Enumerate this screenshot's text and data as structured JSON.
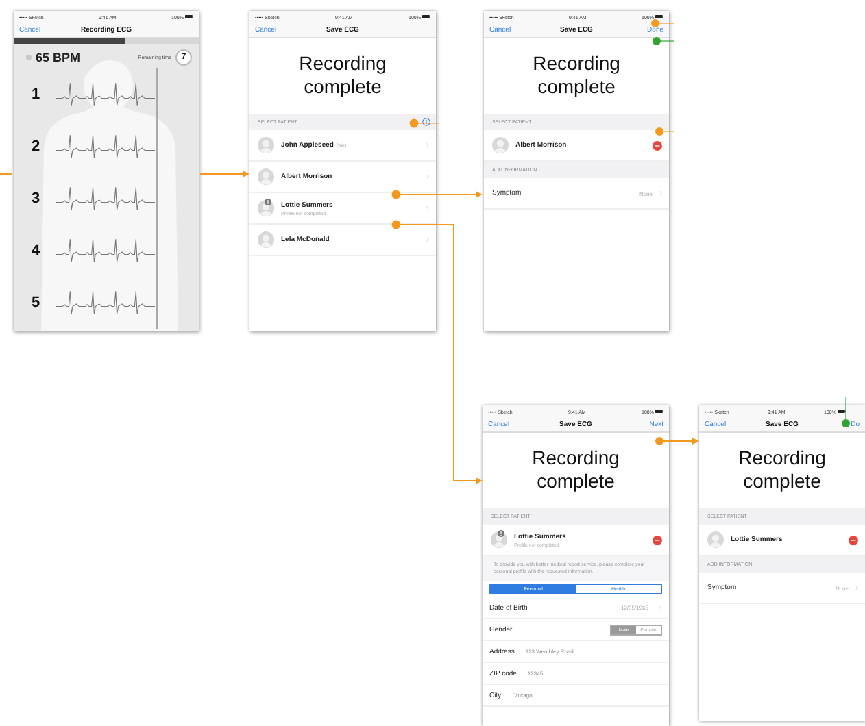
{
  "screens": [
    {
      "kind": "recording",
      "status": {
        "carrier": "••••• Sketch",
        "time": "9:41 AM",
        "battery": "100%"
      },
      "nav": {
        "left": "Cancel",
        "title": "Recording ECG"
      },
      "progress": {
        "level": 0.6
      },
      "bpm": "65 BPM",
      "remaining_label": "Remaining time",
      "remaining": "7",
      "leads": [
        "1",
        "2",
        "3",
        "4",
        "5"
      ]
    },
    {
      "kind": "save",
      "status": {
        "carrier": "••••• Sketch",
        "time": "9:41 AM",
        "battery": "100%"
      },
      "nav": {
        "left": "Cancel",
        "title": "Save ECG"
      },
      "heading": "Recording complete",
      "sections": [
        {
          "header": "SELECT PATIENT",
          "info": true,
          "rows": [
            {
              "kind": "patient",
              "name": "John Appleseed",
              "tag": "(me)",
              "deletable": false
            },
            {
              "kind": "patient",
              "name": "Albert Morrison",
              "deletable": false
            },
            {
              "kind": "patient",
              "name": "Lottie Summers",
              "subtitle": "Profile not completed",
              "badge": true,
              "deletable": false
            },
            {
              "kind": "patient",
              "name": "Lela McDonald",
              "deletable": false
            }
          ]
        }
      ]
    },
    {
      "kind": "save",
      "status": {
        "carrier": "••••• Sketch",
        "time": "9:41 AM",
        "battery": "100%"
      },
      "nav": {
        "left": "Cancel",
        "title": "Save ECG",
        "right": "Done"
      },
      "heading": "Recording complete",
      "sections": [
        {
          "header": "SELECT PATIENT",
          "rows": [
            {
              "kind": "patient",
              "name": "Albert Morrison",
              "deletable": true
            }
          ]
        },
        {
          "header": "ADD INFORMATION",
          "rows": [
            {
              "kind": "field",
              "label": "Symptom",
              "value": "None",
              "deletable": false
            }
          ]
        }
      ]
    },
    {
      "kind": "save",
      "status": {
        "carrier": "••••• Sketch",
        "time": "9:41 AM",
        "battery": "100%"
      },
      "nav": {
        "left": "Cancel",
        "title": "Save ECG",
        "right": "Next"
      },
      "heading": "Recording complete",
      "sections": [
        {
          "header": "SELECT PATIENT",
          "rows": [
            {
              "kind": "patient",
              "name": "Lottie Summers",
              "subtitle": "Profile not completed",
              "badge": true,
              "deletable": true
            }
          ]
        }
      ],
      "profile_form": {
        "notice": "To provide you with better medical report service, please complete your personal profile with the requested information.",
        "tabs": [
          {
            "label": "Personal",
            "selected": true
          },
          {
            "label": "Health",
            "selected": false
          }
        ],
        "fields": [
          {
            "kind": "value",
            "label": "Date of Birth",
            "value": "12/05/1965"
          },
          {
            "kind": "segmented",
            "label": "Gender",
            "options": [
              {
                "label": "Male",
                "selected": true
              },
              {
                "label": "Female",
                "selected": false
              }
            ]
          },
          {
            "kind": "input",
            "label": "Address",
            "placeholder": "123 Wembley Road"
          },
          {
            "kind": "input",
            "label": "ZIP code",
            "placeholder": "12345"
          },
          {
            "kind": "input",
            "label": "City",
            "placeholder": "Chicago"
          }
        ]
      }
    },
    {
      "kind": "save",
      "status": {
        "carrier": "••••• Sketch",
        "time": "9:41 AM",
        "battery": "100%"
      },
      "nav": {
        "left": "Cancel",
        "title": "Save ECG",
        "right": "Do"
      },
      "heading": "Recording complete",
      "sections": [
        {
          "header": "SELECT PATIENT",
          "rows": [
            {
              "kind": "patient",
              "name": "Lottie Summers",
              "deletable": true
            }
          ]
        },
        {
          "header": "ADD INFORMATION",
          "rows": [
            {
              "kind": "field",
              "label": "Symptom",
              "value": "None",
              "deletable": false
            }
          ]
        }
      ]
    }
  ]
}
